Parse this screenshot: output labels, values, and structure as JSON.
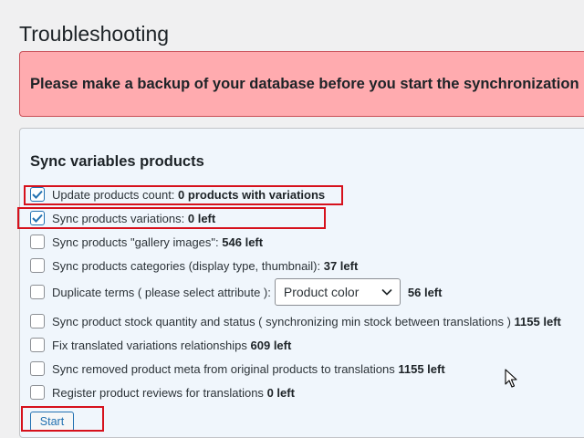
{
  "page": {
    "title": "Troubleshooting"
  },
  "notice": {
    "text": "Please make a backup of your database before you start the synchronization"
  },
  "panel": {
    "title": "Sync variables products",
    "items": [
      {
        "label": "Update products count: ",
        "value": "0  products with variations",
        "checked": true
      },
      {
        "label": "Sync products variations: ",
        "value": "0  left",
        "checked": true
      },
      {
        "label": "Sync products \"gallery images\": ",
        "value": "546  left",
        "checked": false
      },
      {
        "label": "Sync products categories (display type, thumbnail): ",
        "value": "37  left",
        "checked": false
      },
      {
        "label": "Duplicate terms ( please select attribute ):",
        "value": "56  left",
        "checked": false,
        "select_value": "Product color"
      },
      {
        "label": "Sync product stock quantity and status ( synchronizing min stock between translations ) ",
        "value": "1155 left",
        "checked": false
      },
      {
        "label": "Fix translated variations relationships ",
        "value": "609 left",
        "checked": false
      },
      {
        "label": "Sync removed product meta from original products to translations ",
        "value": "1155 left",
        "checked": false
      },
      {
        "label": "Register product reviews for translations ",
        "value": "0 left",
        "checked": false
      }
    ],
    "start_label": "Start"
  },
  "colors": {
    "notice_bg": "#ffabaf",
    "panel_bg": "#f0f6fc",
    "highlight": "#d6111c",
    "accent": "#2271b1"
  }
}
